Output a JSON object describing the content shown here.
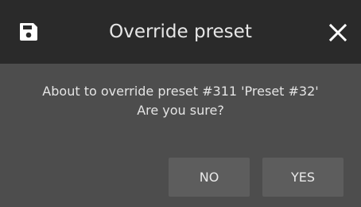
{
  "dialog": {
    "title": "Override preset",
    "title_icon": "save-icon",
    "close_icon": "close-icon",
    "message_line1": "About to override preset #311 'Preset #32'",
    "message_line2": "Are you sure?",
    "buttons": {
      "no_label": "NO",
      "yes_label": "YES"
    }
  },
  "colors": {
    "titlebar": "#2a2a2a",
    "body": "#4d4d4d",
    "button": "#5d5d5d",
    "text": "#ececec"
  }
}
